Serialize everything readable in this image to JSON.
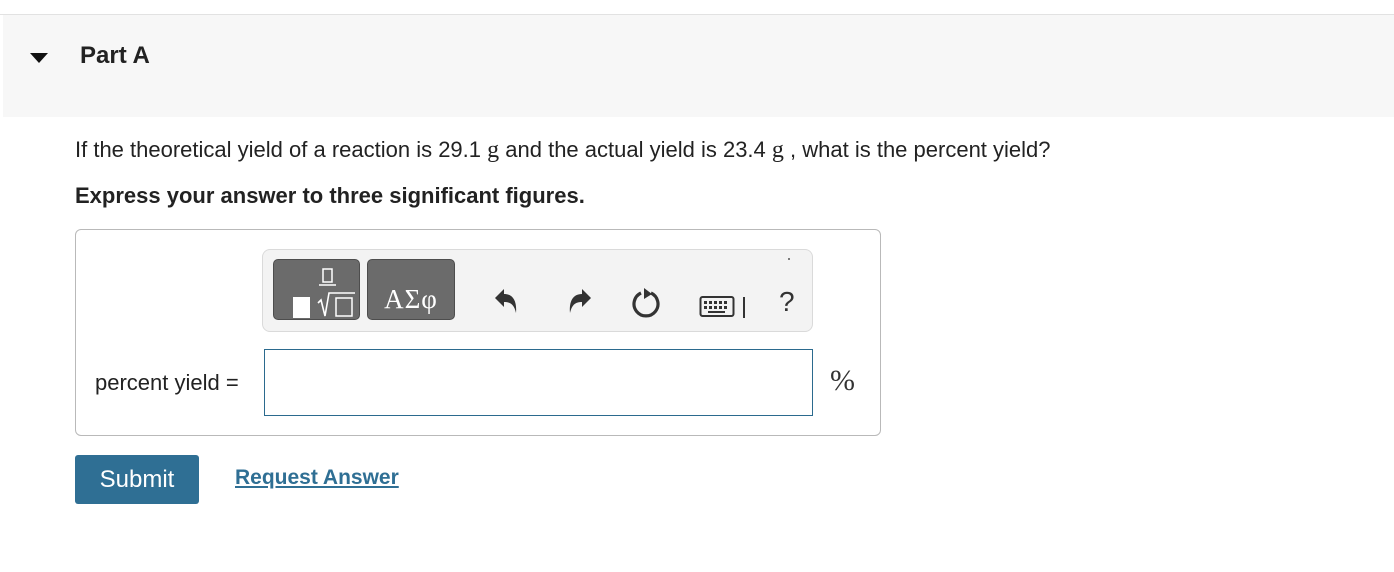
{
  "part": {
    "title": "Part A",
    "expanded": true
  },
  "question": {
    "text_prefix": "If the theoretical yield of a reaction is 29.1",
    "unit1": "g",
    "text_middle": "and the actual yield is 23.4",
    "unit2": "g",
    "text_suffix": ", what is the percent yield?",
    "instruction": "Express your answer to three significant figures."
  },
  "toolbar": {
    "templates_icon": "fraction-sqrt-templates-icon",
    "greek_label": "ΑΣφ",
    "undo_icon": "undo-icon",
    "redo_icon": "redo-icon",
    "reset_icon": "reset-icon",
    "keyboard_icon": "keyboard-icon",
    "help_label": "?"
  },
  "answer": {
    "label": "percent yield =",
    "value": "",
    "unit": "%"
  },
  "actions": {
    "submit_label": "Submit",
    "request_label": "Request Answer"
  },
  "colors": {
    "accent": "#2f6f94",
    "toolbar_button": "#6b6b6b",
    "header_bg": "#f7f7f7"
  }
}
